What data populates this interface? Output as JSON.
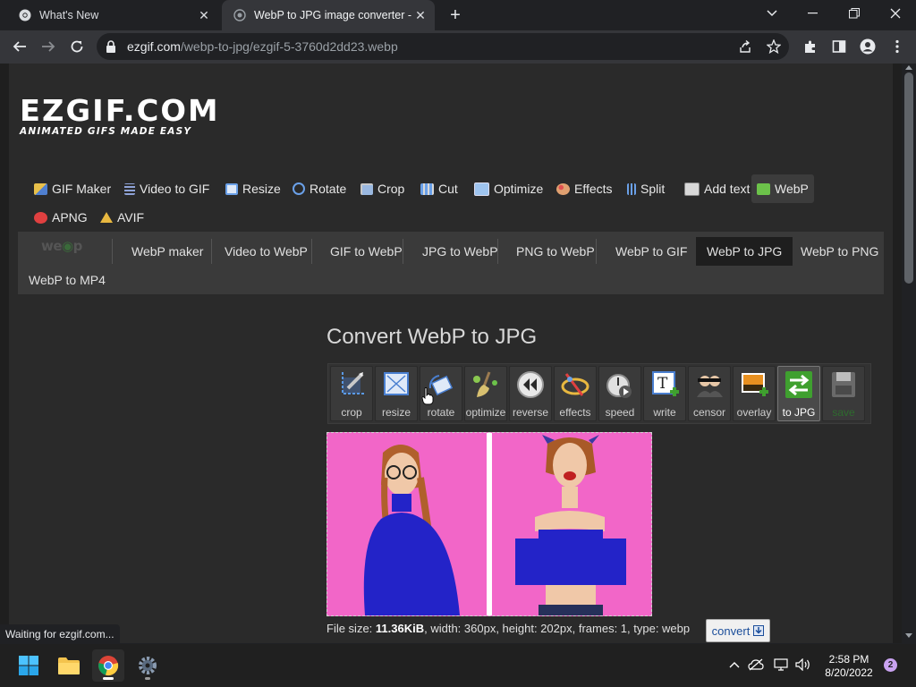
{
  "browser": {
    "tabs": [
      {
        "title": "What's New",
        "active": false
      },
      {
        "title": "WebP to JPG image converter - E",
        "active": true
      }
    ],
    "new_tab_symbol": "+",
    "url_host": "ezgif.com",
    "url_path": "/webp-to-jpg/ezgif-5-3760d2dd23.webp",
    "status_text": "Waiting for ezgif.com..."
  },
  "site": {
    "logo_text": "EZGIF.COM",
    "tagline": "ANIMATED GIFS MADE EASY",
    "main_nav": [
      {
        "label": "GIF Maker",
        "icon": "gif-maker-icon",
        "color": "#e8c04a"
      },
      {
        "label": "Video to GIF",
        "icon": "film-icon",
        "color": "#8fa3d8"
      },
      {
        "label": "Resize",
        "icon": "resize-icon",
        "color": "#6aa0e8"
      },
      {
        "label": "Rotate",
        "icon": "rotate-icon",
        "color": "#6aa0e8"
      },
      {
        "label": "Crop",
        "icon": "crop-icon",
        "color": "#c8c8c8"
      },
      {
        "label": "Cut",
        "icon": "cut-icon",
        "color": "#6aa0e8"
      },
      {
        "label": "Optimize",
        "icon": "optimize-icon",
        "color": "#9ec4ef"
      },
      {
        "label": "Effects",
        "icon": "palette-icon",
        "color": "#e0a070"
      },
      {
        "label": "Split",
        "icon": "split-icon",
        "color": "#6aa0e8"
      },
      {
        "label": "Add text",
        "icon": "text-icon",
        "color": "#d8d8d8"
      },
      {
        "label": "WebP",
        "icon": "webp-icon",
        "color": "#6cc24a",
        "selected": true
      },
      {
        "label": "APNG",
        "icon": "apng-icon",
        "color": "#e04040"
      },
      {
        "label": "AVIF",
        "icon": "avif-icon",
        "color": "#e8b840"
      }
    ],
    "sub_nav": [
      {
        "label": "WebP maker"
      },
      {
        "label": "Video to WebP"
      },
      {
        "label": "GIF to WebP"
      },
      {
        "label": "JPG to WebP"
      },
      {
        "label": "PNG to WebP"
      },
      {
        "label": "WebP to GIF"
      },
      {
        "label": "WebP to JPG",
        "selected": true
      },
      {
        "label": "WebP to PNG"
      },
      {
        "label": "WebP to MP4"
      }
    ],
    "page_title": "Convert WebP to JPG",
    "tools": [
      {
        "label": "crop",
        "icon": "crop-tool-icon"
      },
      {
        "label": "resize",
        "icon": "resize-tool-icon"
      },
      {
        "label": "rotate",
        "icon": "rotate-tool-icon"
      },
      {
        "label": "optimize",
        "icon": "broom-icon"
      },
      {
        "label": "reverse",
        "icon": "reverse-icon"
      },
      {
        "label": "effects",
        "icon": "effects-icon"
      },
      {
        "label": "speed",
        "icon": "stopwatch-icon"
      },
      {
        "label": "write",
        "icon": "write-icon"
      },
      {
        "label": "censor",
        "icon": "censor-icon"
      },
      {
        "label": "overlay",
        "icon": "overlay-icon"
      },
      {
        "label": "to JPG",
        "icon": "convert-icon",
        "selected": true
      },
      {
        "label": "save",
        "icon": "floppy-icon",
        "disabled": true
      }
    ],
    "file_info": {
      "prefix": "File size: ",
      "size": "11.36KiB",
      "rest": ", width: 360px, height: 202px, frames: 1, type: webp"
    },
    "convert_label": "convert"
  },
  "taskbar": {
    "time": "2:58 PM",
    "date": "8/20/2022",
    "notifications": "2"
  },
  "colors": {
    "page_bg": "#2a2a2a",
    "preview_bg": "#f266c8",
    "shirt": "#2323c8",
    "accent_green": "#3fa02f"
  }
}
